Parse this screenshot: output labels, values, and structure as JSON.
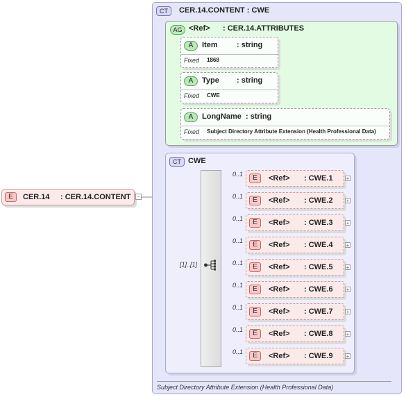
{
  "root_element": {
    "badge": "E",
    "name": "CER.14",
    "type_label": ": CER.14.CONTENT",
    "collapse_glyph": "−"
  },
  "complex_type": {
    "badge": "CT",
    "title": "CER.14.CONTENT : CWE",
    "footer": "Subject Directory Attribute Extension (Health Professional Data)"
  },
  "attribute_group": {
    "badge": "AG",
    "ref": "<Ref>",
    "name": ": CER.14.ATTRIBUTES",
    "attributes": [
      {
        "badge": "A",
        "name": "Item",
        "type": ": string",
        "fixed_label": "Fixed",
        "fixed_value": "1868"
      },
      {
        "badge": "A",
        "name": "Type",
        "type": ": string",
        "fixed_label": "Fixed",
        "fixed_value": "CWE"
      },
      {
        "badge": "A",
        "name": "LongName",
        "type": ": string",
        "fixed_label": "Fixed",
        "fixed_value": "Subject Directory Attribute Extension (Health Professional Data)"
      }
    ]
  },
  "inner_type": {
    "badge": "CT",
    "title": "CWE"
  },
  "sequence": {
    "occurrence": "[1]..[1]"
  },
  "children": [
    {
      "badge": "E",
      "ref": "<Ref>",
      "name": ": CWE.1",
      "occurrence": "0..1"
    },
    {
      "badge": "E",
      "ref": "<Ref>",
      "name": ": CWE.2",
      "occurrence": "0..1"
    },
    {
      "badge": "E",
      "ref": "<Ref>",
      "name": ": CWE.3",
      "occurrence": "0..1"
    },
    {
      "badge": "E",
      "ref": "<Ref>",
      "name": ": CWE.4",
      "occurrence": "0..1"
    },
    {
      "badge": "E",
      "ref": "<Ref>",
      "name": ": CWE.5",
      "occurrence": "0..1"
    },
    {
      "badge": "E",
      "ref": "<Ref>",
      "name": ": CWE.6",
      "occurrence": "0..1"
    },
    {
      "badge": "E",
      "ref": "<Ref>",
      "name": ": CWE.7",
      "occurrence": "0..1"
    },
    {
      "badge": "E",
      "ref": "<Ref>",
      "name": ": CWE.8",
      "occurrence": "0..1"
    },
    {
      "badge": "E",
      "ref": "<Ref>",
      "name": ": CWE.9",
      "occurrence": "0..1"
    }
  ],
  "expand_glyph": "+"
}
